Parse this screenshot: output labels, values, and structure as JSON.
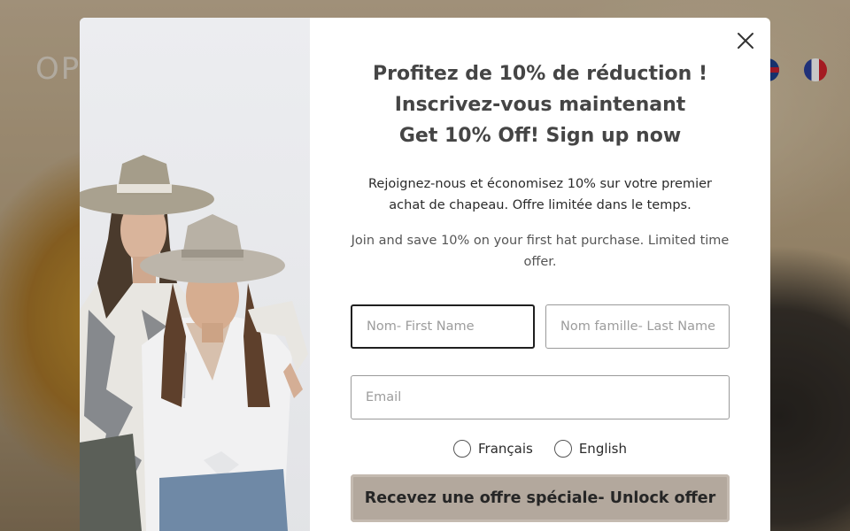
{
  "background": {
    "logo_text": "OP",
    "flags": [
      "uk-flag-icon",
      "fr-flag-icon"
    ]
  },
  "popup": {
    "headline": [
      "Profitez de 10% de réduction !",
      "Inscrivez-vous maintenant",
      "Get 10% Off! Sign up now"
    ],
    "description_fr": "Rejoignez-nous et économisez 10% sur votre premier achat de chapeau. Offre limitée dans le temps.",
    "description_en": "Join and save 10% on your first hat purchase. Limited time offer.",
    "fields": {
      "first_name": {
        "placeholder": "Nom- First Name",
        "value": ""
      },
      "last_name": {
        "placeholder": "Nom famille- Last Name",
        "value": ""
      },
      "email": {
        "placeholder": "Email",
        "value": ""
      }
    },
    "languages": [
      {
        "label": "Français",
        "checked": false
      },
      {
        "label": "English",
        "checked": false
      }
    ],
    "cta_label": "Recevez une offre spéciale- Unlock offer",
    "close_icon": "close-icon",
    "colors": {
      "cta_background": "#b3a89d",
      "headline_text": "#454545"
    }
  }
}
